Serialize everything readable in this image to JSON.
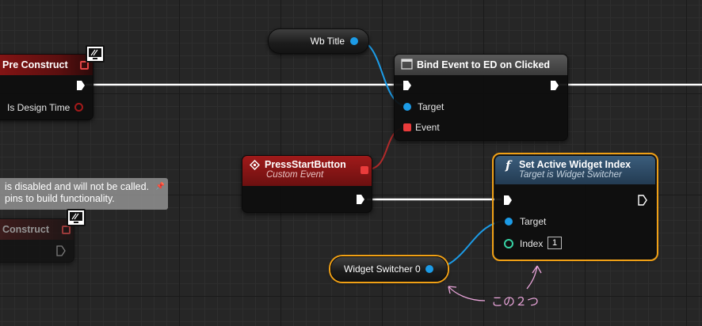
{
  "nodes": {
    "pre_construct": {
      "title": "Pre Construct",
      "pin_label": "Is Design Time"
    },
    "construct_disabled": {
      "title": "Construct"
    },
    "comment": {
      "line1": "is disabled and will not be called.",
      "line2": "pins to build functionality."
    },
    "wb_title": {
      "label": "Wb Title"
    },
    "bind_event": {
      "title": "Bind Event to ED on Clicked",
      "target_label": "Target",
      "event_label": "Event"
    },
    "press_start": {
      "title": "PressStartButton",
      "subtitle": "Custom Event"
    },
    "set_active": {
      "title": "Set Active Widget Index",
      "subtitle": "Target is Widget Switcher",
      "target_label": "Target",
      "index_label": "Index",
      "index_value": "1"
    },
    "widget_switcher": {
      "label": "Widget Switcher 0"
    }
  },
  "annotation": {
    "text": "この２つ"
  },
  "colors": {
    "exec_wire": "#ffffff",
    "object_wire": "#1c9be6",
    "delegate_wire": "#b02a2a",
    "selection": "#f0a015",
    "annotation": "#e9a5da"
  },
  "icons": [
    "monitor-icon",
    "function-icon",
    "event-icon",
    "bind-event-icon"
  ]
}
